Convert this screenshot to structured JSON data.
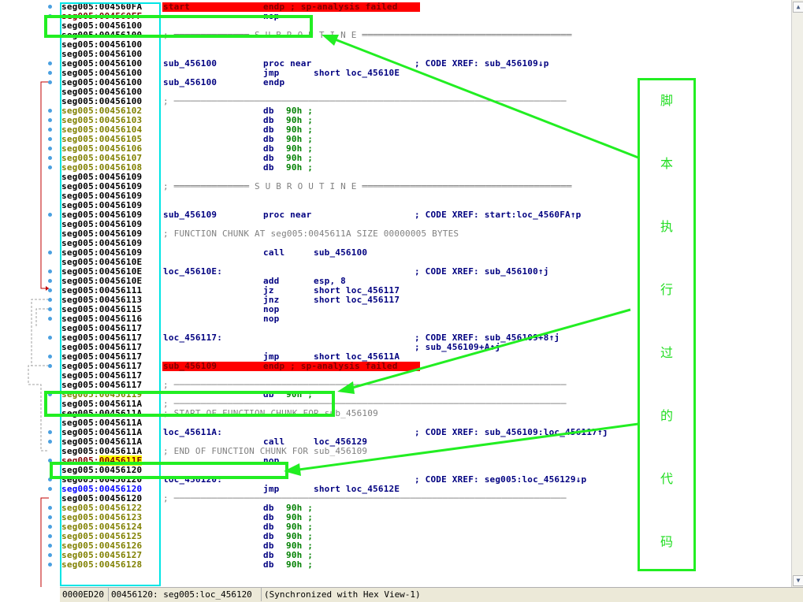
{
  "listing": [
    {
      "addr": "seg005:004560FA",
      "ac": "dark",
      "label": "start",
      "mnem": "endp ; sp-analysis failed",
      "err": true
    },
    {
      "addr": "seg005:004560FF",
      "ac": "red",
      "mnem": "nop"
    },
    {
      "addr": "seg005:00456100",
      "ac": "dark"
    },
    {
      "addr": "seg005:00456100",
      "ac": "dark",
      "sep": "; ══════════════ S U B R O U T I N E ═══════════════════════════════════════"
    },
    {
      "addr": "seg005:00456100",
      "ac": "dark"
    },
    {
      "addr": "seg005:00456100",
      "ac": "dark"
    },
    {
      "addr": "seg005:00456100",
      "ac": "dark",
      "label": "sub_456100",
      "mnem": "proc near",
      "cmt": "; CODE XREF: sub_456109↓p"
    },
    {
      "addr": "seg005:00456100",
      "ac": "dark",
      "mnem": "jmp",
      "ops": "short loc_45610E"
    },
    {
      "addr": "seg005:00456100",
      "ac": "dark",
      "label": "sub_456100",
      "mnem": "endp"
    },
    {
      "addr": "seg005:00456100",
      "ac": "dark"
    },
    {
      "addr": "seg005:00456100",
      "ac": "dark",
      "sep": "; ─────────────────────────────────────────────────────────────────────────"
    },
    {
      "addr": "seg005:00456102",
      "ac": "olive",
      "mnem": "db",
      "db": "90h ;"
    },
    {
      "addr": "seg005:00456103",
      "ac": "olive",
      "mnem": "db",
      "db": "90h ;"
    },
    {
      "addr": "seg005:00456104",
      "ac": "olive",
      "mnem": "db",
      "db": "90h ;"
    },
    {
      "addr": "seg005:00456105",
      "ac": "olive",
      "mnem": "db",
      "db": "90h ;"
    },
    {
      "addr": "seg005:00456106",
      "ac": "olive",
      "mnem": "db",
      "db": "90h ;"
    },
    {
      "addr": "seg005:00456107",
      "ac": "olive",
      "mnem": "db",
      "db": "90h ;"
    },
    {
      "addr": "seg005:00456108",
      "ac": "olive",
      "mnem": "db",
      "db": "90h ;"
    },
    {
      "addr": "seg005:00456109",
      "ac": "dark"
    },
    {
      "addr": "seg005:00456109",
      "ac": "dark",
      "sep": "; ══════════════ S U B R O U T I N E ═══════════════════════════════════════"
    },
    {
      "addr": "seg005:00456109",
      "ac": "dark"
    },
    {
      "addr": "seg005:00456109",
      "ac": "dark"
    },
    {
      "addr": "seg005:00456109",
      "ac": "dark",
      "label": "sub_456109",
      "mnem": "proc near",
      "cmt": "; CODE XREF: start:loc_4560FA↑p"
    },
    {
      "addr": "seg005:00456109",
      "ac": "dark"
    },
    {
      "addr": "seg005:00456109",
      "ac": "dark",
      "sep": "; FUNCTION CHUNK AT seg005:0045611A SIZE 00000005 BYTES"
    },
    {
      "addr": "seg005:00456109",
      "ac": "dark"
    },
    {
      "addr": "seg005:00456109",
      "ac": "dark",
      "mnem": "call",
      "ops": "sub_456100"
    },
    {
      "addr": "seg005:0045610E",
      "ac": "dark"
    },
    {
      "addr": "seg005:0045610E",
      "ac": "dark",
      "label": "loc_45610E:",
      "cmt": "; CODE XREF: sub_456100↑j"
    },
    {
      "addr": "seg005:0045610E",
      "ac": "dark",
      "mnem": "add",
      "ops": "esp, 8"
    },
    {
      "addr": "seg005:00456111",
      "ac": "dark",
      "mnem": "jz",
      "ops": "short loc_456117"
    },
    {
      "addr": "seg005:00456113",
      "ac": "dark",
      "mnem": "jnz",
      "ops": "short loc_456117"
    },
    {
      "addr": "seg005:00456115",
      "ac": "dark",
      "mnem": "nop"
    },
    {
      "addr": "seg005:00456116",
      "ac": "dark",
      "mnem": "nop"
    },
    {
      "addr": "seg005:00456117",
      "ac": "dark"
    },
    {
      "addr": "seg005:00456117",
      "ac": "dark",
      "label": "loc_456117:",
      "cmt": "; CODE XREF: sub_456109+8↑j"
    },
    {
      "addr": "seg005:00456117",
      "ac": "dark",
      "cmt": "; sub_456109+A↑j"
    },
    {
      "addr": "seg005:00456117",
      "ac": "dark",
      "mnem": "jmp",
      "ops": "short loc_45611A"
    },
    {
      "addr": "seg005:00456117",
      "ac": "dark",
      "label": "sub_456109",
      "mnem": "endp ; sp-analysis failed",
      "err": true
    },
    {
      "addr": "seg005:00456117",
      "ac": "dark"
    },
    {
      "addr": "seg005:00456117",
      "ac": "dark",
      "sep": "; ─────────────────────────────────────────────────────────────────────────"
    },
    {
      "addr": "seg005:00456119",
      "ac": "olive",
      "mnem": "db",
      "db": "90h ;"
    },
    {
      "addr": "seg005:0045611A",
      "ac": "dark",
      "sep": "; ─────────────────────────────────────────────────────────────────────────"
    },
    {
      "addr": "seg005:0045611A",
      "ac": "dark",
      "sep": "; START OF FUNCTION CHUNK FOR sub_456109"
    },
    {
      "addr": "seg005:0045611A",
      "ac": "dark"
    },
    {
      "addr": "seg005:0045611A",
      "ac": "dark",
      "label": "loc_45611A:",
      "cmt": "; CODE XREF: sub_456109:loc_456117↑j"
    },
    {
      "addr": "seg005:0045611A",
      "ac": "dark",
      "mnem": "call",
      "ops": "loc_456129"
    },
    {
      "addr": "seg005:0045611A",
      "ac": "dark",
      "sep": "; END OF FUNCTION CHUNK FOR sub_456109"
    },
    {
      "addr": "seg005:0045611F",
      "ac": "red",
      "hl": true,
      "mnem": "nop"
    },
    {
      "addr": "seg005:00456120",
      "ac": "dark"
    },
    {
      "addr": "seg005:00456120",
      "ac": "dark",
      "label": "loc_456120:",
      "cmt": "; CODE XREF: seg005:loc_456129↓p"
    },
    {
      "addr": "seg005:00456120",
      "ac": "blue",
      "mnem": "jmp",
      "ops": "short loc_45612E"
    },
    {
      "addr": "seg005:00456120",
      "ac": "dark",
      "sep": "; ─────────────────────────────────────────────────────────────────────────"
    },
    {
      "addr": "seg005:00456122",
      "ac": "olive",
      "mnem": "db",
      "db": "90h ;"
    },
    {
      "addr": "seg005:00456123",
      "ac": "olive",
      "mnem": "db",
      "db": "90h ;"
    },
    {
      "addr": "seg005:00456124",
      "ac": "olive",
      "mnem": "db",
      "db": "90h ;"
    },
    {
      "addr": "seg005:00456125",
      "ac": "olive",
      "mnem": "db",
      "db": "90h ;"
    },
    {
      "addr": "seg005:00456126",
      "ac": "olive",
      "mnem": "db",
      "db": "90h ;"
    },
    {
      "addr": "seg005:00456127",
      "ac": "olive",
      "mnem": "db",
      "db": "90h ;"
    },
    {
      "addr": "seg005:00456128",
      "ac": "olive",
      "mnem": "db",
      "db": "90h ;"
    }
  ],
  "status": {
    "offset": "0000ED20",
    "location": "00456120: seg005:loc_456120",
    "sync": "(Synchronized with Hex View-1)"
  },
  "annotation": {
    "chars": [
      "脚",
      "本",
      "执",
      "行",
      "过",
      "的",
      "代",
      "码"
    ],
    "color": "#22ee22"
  },
  "icons": {
    "scroll_up": "scroll-up-arrow-icon",
    "scroll_down": "scroll-down-arrow-icon"
  },
  "colors": {
    "error_band": "#ff0000",
    "addr_frame": "#00e5e5",
    "annotation": "#22ee22",
    "highlight": "#ffff00"
  }
}
